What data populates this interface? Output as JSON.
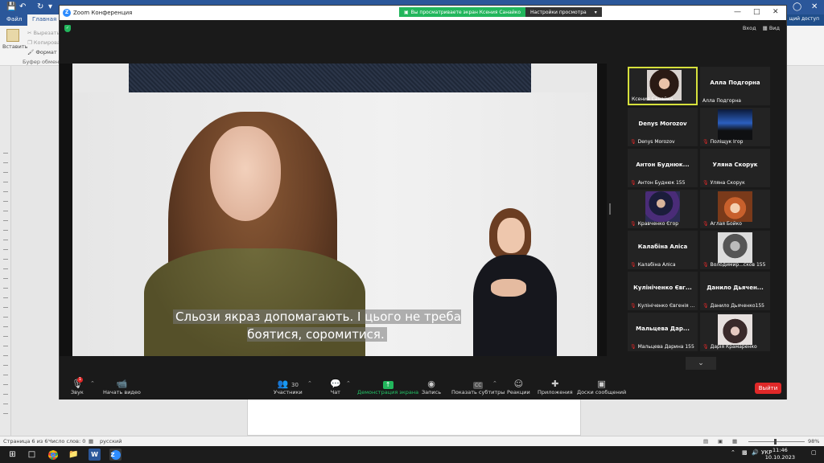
{
  "word": {
    "tabs": {
      "file": "Файл",
      "home": "Главная"
    },
    "share": "щий доступ",
    "clipboard": {
      "cut": "Вырезать",
      "copy": "Копирова",
      "format": "Формат по",
      "paste": "Вставить",
      "group": "Буфер обмена"
    },
    "status": {
      "page": "Страница 6 из 6",
      "words": "Число слов: 0",
      "lang": "русский",
      "zoom": "98%"
    }
  },
  "taskbar": {
    "lang": "УКР",
    "time": "11:46",
    "date": "10.10.2023"
  },
  "zoom": {
    "title": "Zoom Конференция",
    "banner": {
      "viewing": "Вы просматриваете экран Ксения Санайко",
      "view_settings": "Настройки просмотра"
    },
    "view_buttons": {
      "enter": "Вход",
      "view": "Вид"
    },
    "subtitle": "Сльози якраз допомагають. І цього не треба боятися, соромитися.",
    "gallery": [
      {
        "name": "",
        "label": "Ксения Санайко",
        "has_video": true,
        "muted": false
      },
      {
        "name": "Алла Подгорна",
        "label": "Алла Подгорна",
        "has_video": false,
        "muted": false
      },
      {
        "name": "Denys Morozov",
        "label": "Denys Morozov",
        "has_video": false,
        "muted": true
      },
      {
        "name": "",
        "label": "Поліщук Ігор",
        "has_video": true,
        "muted": true
      },
      {
        "name": "Антон Буднюк...",
        "label": "Антон Буднюк 155",
        "has_video": false,
        "muted": true
      },
      {
        "name": "Уляна Скорук",
        "label": "Уляна Скорук",
        "has_video": false,
        "muted": true
      },
      {
        "name": "",
        "label": "Кравченко Єгор",
        "has_video": true,
        "muted": true
      },
      {
        "name": "",
        "label": "Аглая Бойко",
        "has_video": true,
        "muted": true
      },
      {
        "name": "Калабіна Аліса",
        "label": "Калабіна Аліса",
        "has_video": false,
        "muted": true
      },
      {
        "name": "",
        "label": "Володимир...сков 155",
        "has_video": true,
        "muted": true
      },
      {
        "name": "Кулініченко Євг...",
        "label": "Кулініченко Євгенія ...",
        "has_video": false,
        "muted": true
      },
      {
        "name": "Данило Дьячен...",
        "label": "Данило Дьяченко155",
        "has_video": false,
        "muted": true
      },
      {
        "name": "Мальцева Дар...",
        "label": "Мальцева Дарина 155",
        "has_video": false,
        "muted": true
      },
      {
        "name": "",
        "label": "Дарія Крамаренко",
        "has_video": true,
        "muted": true
      }
    ],
    "toolbar": {
      "audio": "Звук",
      "audio_badge": "1",
      "video": "Начать видео",
      "participants": "Участники",
      "participants_count": "30",
      "chat": "Чат",
      "share": "Демонстрация экрана",
      "record": "Запись",
      "captions": "Показать субтитры",
      "reactions": "Реакции",
      "apps": "Приложения",
      "whiteboards": "Доски сообщений",
      "leave": "Выйти"
    }
  },
  "colors": {
    "accent_green": "#22b65c",
    "leave_red": "#e02828",
    "word_blue": "#2b579a",
    "active_speaker": "#d6e03c"
  }
}
